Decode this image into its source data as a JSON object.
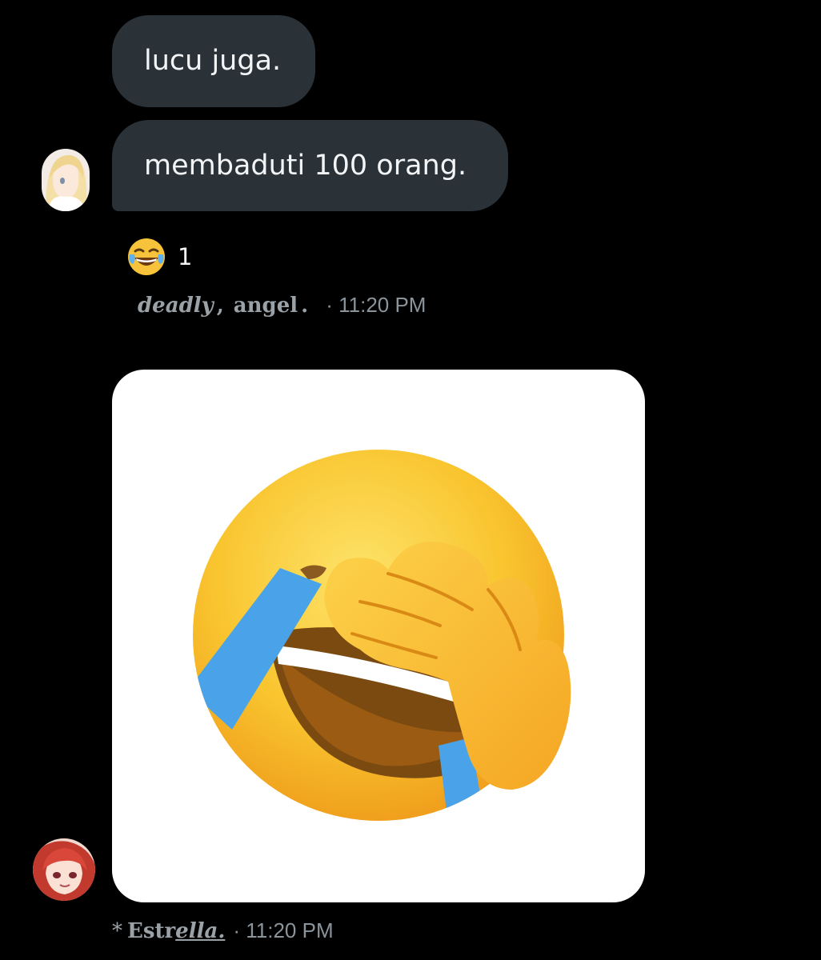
{
  "messages": [
    {
      "text": "lucu juga."
    },
    {
      "text": "membaduti 100 orang."
    }
  ],
  "reaction": {
    "emoji": "😂",
    "count": "1"
  },
  "meta_first": {
    "sender_part1": "deadly",
    "separator": ",",
    "sender_part2": "angel",
    "sender_part2_suffix": ".",
    "time": "· 11:20 PM"
  },
  "meta_second": {
    "prefix": "*",
    "sender_main": "Estr",
    "sender_underlined": "ella.",
    "time": "· 11:20 PM"
  },
  "media": {
    "icon": "face-palm-laughing-emoji"
  },
  "colors": {
    "background": "#000000",
    "bubble": "#2a3238",
    "meta_text": "#8b949b",
    "media_bg": "#ffffff"
  }
}
